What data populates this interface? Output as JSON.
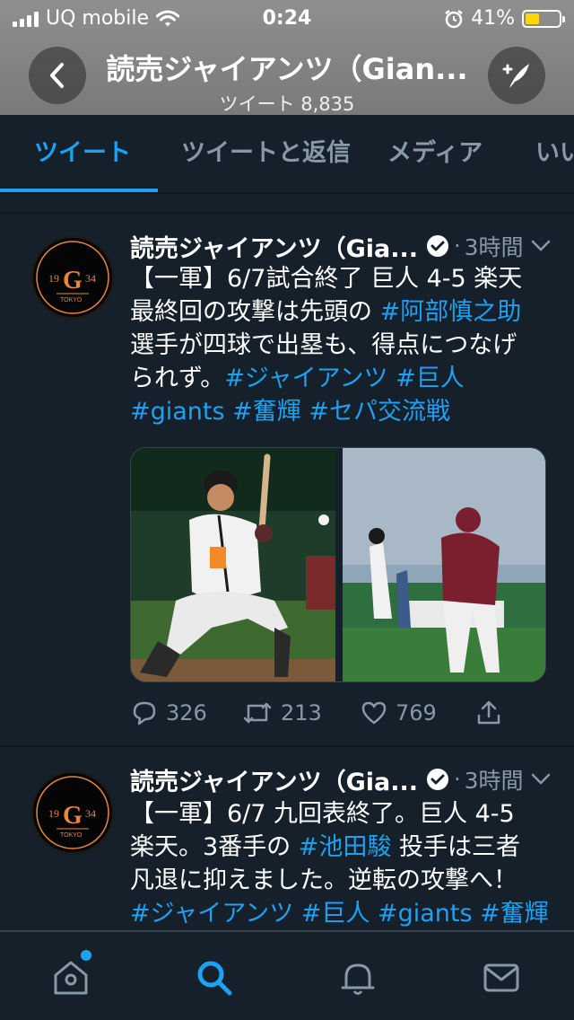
{
  "status_bar": {
    "carrier": "UQ mobile",
    "time": "0:24",
    "battery": "41%",
    "battery_level": 0.41
  },
  "header": {
    "title": "読売ジャイアンツ（Gian...",
    "subtitle": "ツイート 8,835"
  },
  "tabs": [
    {
      "label": "ツイート",
      "active": true
    },
    {
      "label": "ツイートと返信",
      "active": false
    },
    {
      "label": "メディア",
      "active": false
    },
    {
      "label": "いいね",
      "active": false
    }
  ],
  "avatar": {
    "year_left": "19",
    "year_right": "34",
    "letter": "G",
    "city": "TOKYO"
  },
  "tweets": [
    {
      "name": "読売ジャイアンツ（Gia...",
      "time": "3時間",
      "lines": [
        [
          "【一軍】6/7試合終了 巨人 4-5 楽天"
        ],
        [
          "最終回の攻撃は先頭の ",
          "#阿部慎之助"
        ],
        [
          "選手が四球で出塁も、得点につなげ"
        ],
        [
          "られず。",
          "#ジャイアンツ #巨人"
        ],
        [
          "#giants #奮輝 #セパ交流戦"
        ]
      ],
      "replies": "326",
      "retweets": "213",
      "likes": "769"
    },
    {
      "name": "読売ジャイアンツ（Gia...",
      "time": "3時間",
      "lines": [
        [
          "【一軍】6/7 九回表終了。巨人 4-5"
        ],
        [
          "楽天。3番手の ",
          "#池田駿",
          " 投手は三者"
        ],
        [
          "凡退に抑えました。逆転の攻撃へ！"
        ],
        [
          "#ジャイアンツ #巨人 #giants #奮輝"
        ]
      ]
    }
  ],
  "colors": {
    "accent": "#1da1f2",
    "background": "#15202b",
    "muted": "#8899a6",
    "battery": "#ffd60a",
    "logo_orange": "#e8873a"
  }
}
